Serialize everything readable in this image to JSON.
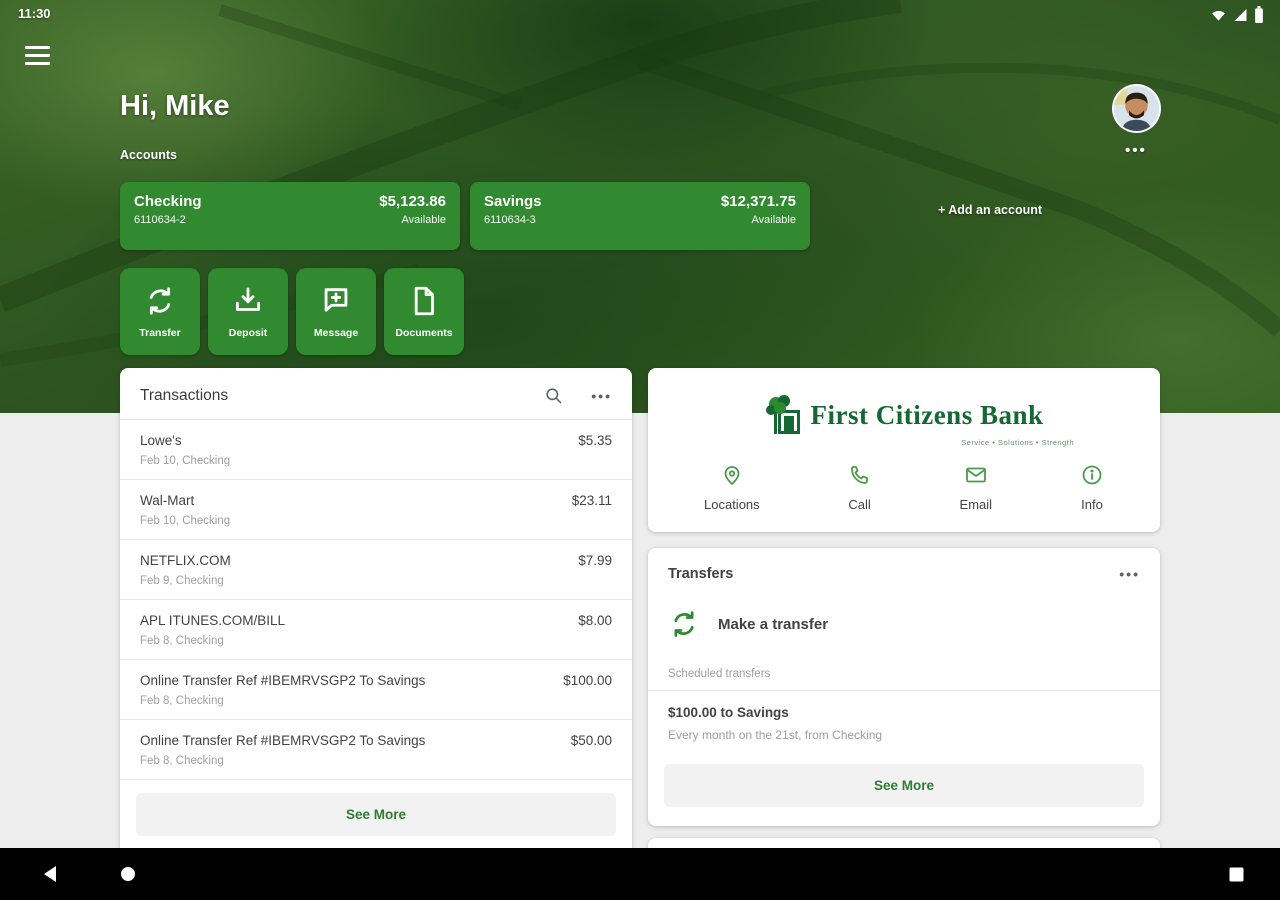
{
  "status_bar": {
    "time": "11:30"
  },
  "header": {
    "greeting": "Hi, Mike",
    "section_label": "Accounts",
    "add_account_label": "+ Add an account",
    "overflow_glyph": "•••"
  },
  "accounts": [
    {
      "name": "Checking",
      "number": "6110634-2",
      "balance": "$5,123.86",
      "balance_label": "Available"
    },
    {
      "name": "Savings",
      "number": "6110634-3",
      "balance": "$12,371.75",
      "balance_label": "Available"
    }
  ],
  "quick_actions": [
    {
      "label": "Transfer",
      "icon": "transfer-icon"
    },
    {
      "label": "Deposit",
      "icon": "deposit-icon"
    },
    {
      "label": "Message",
      "icon": "message-icon"
    },
    {
      "label": "Documents",
      "icon": "documents-icon"
    }
  ],
  "transactions_card": {
    "title": "Transactions",
    "overflow_glyph": "•••",
    "see_more_label": "See More",
    "items": [
      {
        "merchant": "Lowe's",
        "detail": "Feb 10, Checking",
        "amount": "$5.35"
      },
      {
        "merchant": "Wal-Mart",
        "detail": "Feb 10, Checking",
        "amount": "$23.11"
      },
      {
        "merchant": "NETFLIX.COM",
        "detail": "Feb 9, Checking",
        "amount": "$7.99"
      },
      {
        "merchant": "APL ITUNES.COM/BILL",
        "detail": "Feb 8, Checking",
        "amount": "$8.00"
      },
      {
        "merchant": "Online Transfer Ref #IBEMRVSGP2 To Savings",
        "detail": "Feb 8, Checking",
        "amount": "$100.00"
      },
      {
        "merchant": "Online Transfer Ref #IBEMRVSGP2 To Savings",
        "detail": "Feb 8, Checking",
        "amount": "$50.00"
      }
    ]
  },
  "bank_card": {
    "logo_text": "First Citizens Bank",
    "tagline": "Service • Solutions • Strength",
    "actions": [
      {
        "label": "Locations",
        "icon": "location-pin-icon"
      },
      {
        "label": "Call",
        "icon": "phone-icon"
      },
      {
        "label": "Email",
        "icon": "email-icon"
      },
      {
        "label": "Info",
        "icon": "info-icon"
      }
    ]
  },
  "transfers_card": {
    "title": "Transfers",
    "overflow_glyph": "•••",
    "make_transfer_label": "Make a transfer",
    "scheduled_label": "Scheduled transfers",
    "scheduled_items": [
      {
        "title": "$100.00 to Savings",
        "detail": "Every month on the 21st, from Checking"
      }
    ],
    "see_more_label": "See More"
  },
  "colors": {
    "brand_green": "#318a30",
    "logo_green": "#156734",
    "link_green": "#2e7d32",
    "navbar_black": "#000000"
  }
}
